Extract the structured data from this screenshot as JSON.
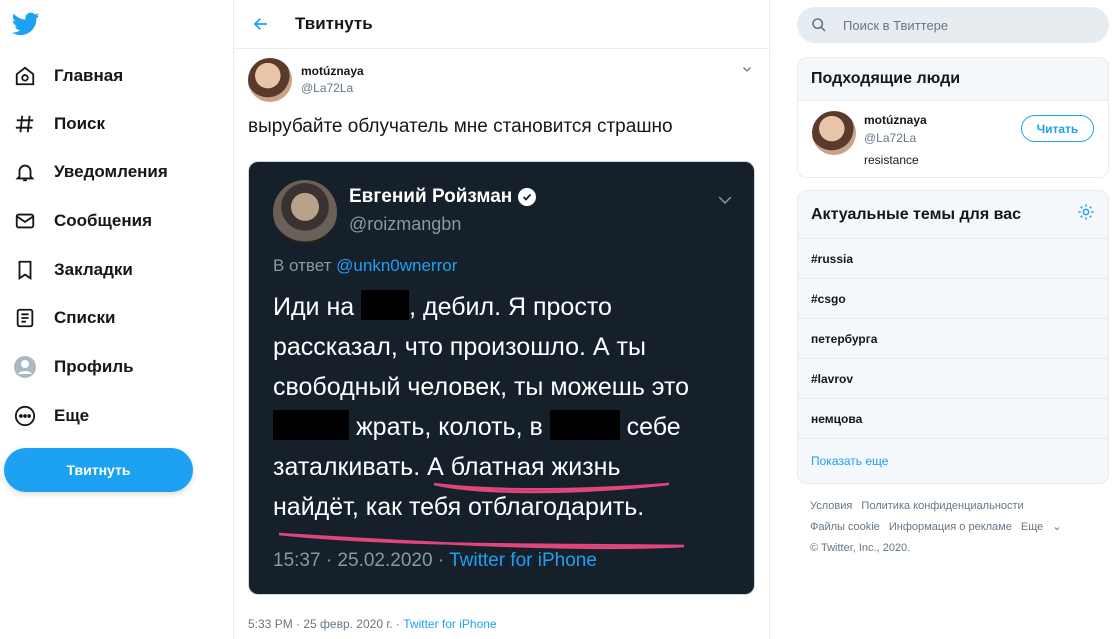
{
  "nav": {
    "items": [
      {
        "label": "Главная",
        "icon": "home-icon"
      },
      {
        "label": "Поиск",
        "icon": "hashtag-icon"
      },
      {
        "label": "Уведомления",
        "icon": "bell-icon"
      },
      {
        "label": "Сообщения",
        "icon": "mail-icon"
      },
      {
        "label": "Закладки",
        "icon": "bookmark-icon"
      },
      {
        "label": "Списки",
        "icon": "list-icon"
      },
      {
        "label": "Профиль",
        "icon": "profile-icon"
      },
      {
        "label": "Еще",
        "icon": "more-icon"
      }
    ],
    "tweet_button": "Твитнуть"
  },
  "header": {
    "title": "Твитнуть"
  },
  "tweet": {
    "author_name": "motúznaya",
    "author_handle": "@La72La",
    "text": "вырубайте облучатель мне становится страшно",
    "meta_time": "5:33 PM · 25 февр. 2020 г. · ",
    "meta_source": "Twitter for iPhone"
  },
  "embedded": {
    "name": "Евгений Ройзман",
    "handle": "@roizmangbn",
    "reply_prefix": "В ответ ",
    "reply_to": "@unkn0wnerror",
    "line1a": "Иди на ",
    "line1b": ", дебил. Я просто",
    "line2": "рассказал, что произошло. А ты",
    "line3": "свободный человек, ты можешь это",
    "line4a": " жрать, колоть, в ",
    "line4b": " себе",
    "line5": "заталкивать. А блатная жизнь",
    "line6": "найдёт, как тебя отблагодарить.",
    "footer_time": "15:37 · 25.02.2020 · ",
    "footer_source": "Twitter for iPhone"
  },
  "search": {
    "placeholder": "Поиск в Твиттере"
  },
  "who_to_follow": {
    "title": "Подходящие люди",
    "name": "motúznaya",
    "handle": "@La72La",
    "bio": "resistance",
    "follow_label": "Читать"
  },
  "trends": {
    "title": "Актуальные темы для вас",
    "items": [
      "#russia",
      "#csgo",
      "петербургa",
      "#lavrov",
      "немцова"
    ],
    "show_more": "Показать еще"
  },
  "footer": {
    "links": [
      "Условия",
      "Политика конфиденциальности",
      "Файлы cookie",
      "Информация о рекламе",
      "Еще"
    ],
    "copyright": "© Twitter, Inc., 2020."
  },
  "colors": {
    "accent": "#1da1f2",
    "dark_bg": "#15202b",
    "scribble": "#e0457b"
  }
}
